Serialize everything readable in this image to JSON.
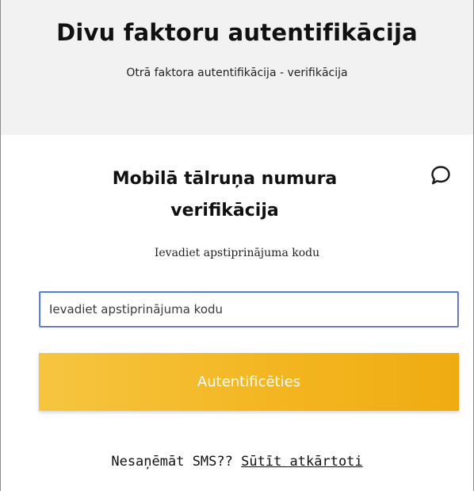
{
  "header": {
    "title": "Divu faktoru autentifikācija",
    "subtitle": "Otrā faktora autentifikācija - verifikācija"
  },
  "card": {
    "title": "Mobilā tālruņa numura verifikācija",
    "chat_icon": "chat-bubble-icon",
    "instruction": "Ievadiet apstiprinājuma kodu",
    "code_input": {
      "placeholder": "Ievadiet apstiprinājuma kodu",
      "value": ""
    },
    "submit_label": "Autentificēties",
    "resend_prompt": "Nesaņēmāt SMS??",
    "resend_link": "Sūtīt atkārtoti"
  },
  "colors": {
    "accent": "#f3b51f",
    "input_focus": "#3d6ad6",
    "header_bg": "#f2f2f2"
  }
}
